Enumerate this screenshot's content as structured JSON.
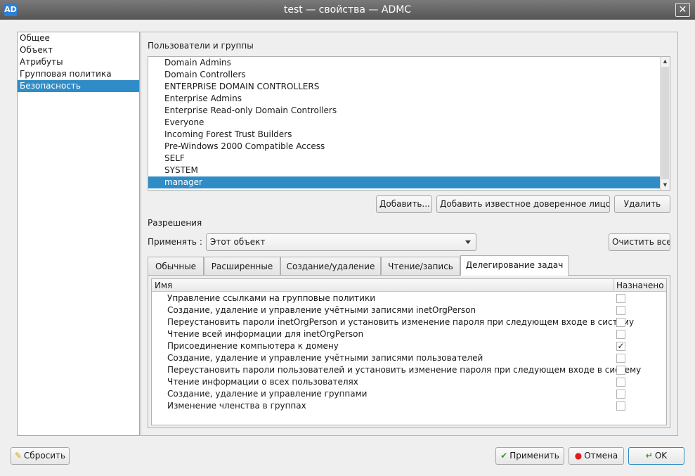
{
  "window": {
    "logo": "AD",
    "title": "test — свойства — ADMC",
    "close_glyph": "✕"
  },
  "nav": {
    "items": [
      "Общее",
      "Объект",
      "Атрибуты",
      "Групповая политика",
      "Безопасность"
    ],
    "selected": "Безопасность"
  },
  "users": {
    "label": "Пользователи и группы",
    "items": [
      "Domain Admins",
      "Domain Controllers",
      "ENTERPRISE DOMAIN CONTROLLERS",
      "Enterprise Admins",
      "Enterprise Read-only Domain Controllers",
      "Everyone",
      "Incoming Forest Trust Builders",
      "Pre-Windows 2000 Compatible Access",
      "SELF",
      "SYSTEM",
      "manager"
    ],
    "selected": "manager",
    "add_label": "Добавить...",
    "add_wellknown_label": "Добавить известное доверенное лицо...",
    "remove_label": "Удалить"
  },
  "permissions": {
    "label": "Разрешения",
    "apply_label": "Применять :",
    "apply_value": "Этот объект",
    "clear_all_label": "Очистить все",
    "tabs": [
      "Обычные",
      "Расширенные",
      "Создание/удаление",
      "Чтение/запись",
      "Делегирование задач"
    ],
    "active_tab": "Делегирование задач",
    "columns": {
      "name": "Имя",
      "assigned": "Назначено"
    },
    "rows": [
      {
        "name": "Управление ссылками на групповые политики",
        "checked": false
      },
      {
        "name": "Создание, удаление и управление учётными записями inetOrgPerson",
        "checked": false
      },
      {
        "name": "Переустановить пароли inetOrgPerson и установить изменение пароля при следующем входе в систему",
        "checked": false
      },
      {
        "name": "Чтение всей информации для inetOrgPerson",
        "checked": false
      },
      {
        "name": "Присоединение компьютера к домену",
        "checked": true
      },
      {
        "name": "Создание, удаление и управление учётными записями пользователей",
        "checked": false
      },
      {
        "name": "Переустановить пароли пользователей и установить изменение пароля при следующем входе в систему",
        "checked": false
      },
      {
        "name": "Чтение информации о всех пользователях",
        "checked": false
      },
      {
        "name": "Создание, удаление и управление группами",
        "checked": false
      },
      {
        "name": "Изменение членства в группах",
        "checked": false
      }
    ]
  },
  "footer": {
    "reset_label": "Сбросить",
    "apply_label": "Применить",
    "cancel_label": "Отмена",
    "ok_label": "OK",
    "icons": {
      "reset": "broom-icon",
      "apply": "checkmark-icon",
      "cancel": "stop-icon",
      "ok": "enter-icon"
    }
  }
}
